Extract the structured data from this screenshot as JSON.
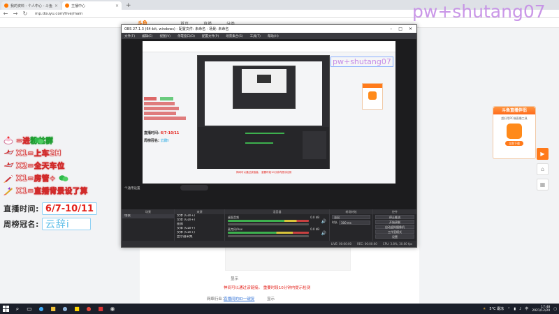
{
  "browser": {
    "tabs": [
      {
        "label": "我的资料 - 个人中心 - 斗鱼",
        "active": false,
        "favicon_color": "#ff7800"
      },
      {
        "label": "主播中心",
        "active": true,
        "favicon_color": "#ff7800"
      }
    ],
    "url": "mp.douyu.com/live/main"
  },
  "page": {
    "nav": [
      "首页",
      "直播",
      "分类"
    ],
    "notice_red": "神间可以通过该链接。 重要时段10分钟内提示检测",
    "footer_label": "网络行业：",
    "footer_link": "直播间的ID一键复",
    "footer_text": "显示"
  },
  "overlay": {
    "gifts": [
      {
        "icon": "gift-cake-icon",
        "text": "=进",
        "highlight": "粉丝群",
        "color": "#d12b2b"
      },
      {
        "icon": "gift-plane-icon",
        "text": "X1=上车2H",
        "highlight": "",
        "color": "#d12b2b"
      },
      {
        "icon": "gift-plane-icon",
        "text": "X2=全天车位",
        "highlight": "",
        "color": "#d12b2b"
      },
      {
        "icon": "gift-rocket-icon",
        "text": "X1=房管+",
        "highlight": "",
        "color": "#d12b2b"
      },
      {
        "icon": "gift-super-rocket-icon",
        "text": "X1=直播背景设了算",
        "highlight": "",
        "color": "#d12b2b"
      }
    ],
    "live_time_label": "直播时间:",
    "live_time_value": "6/7-10/11",
    "weekly_title_label": "周榜冠名:",
    "weekly_title_value": "云辞i"
  },
  "watermark": "pw+shutang07",
  "obs": {
    "title": "OBS 27.1.3 (64-bit, windows) - 配置文件: 未命名 - 场景: 未命名",
    "menu": [
      "文件(F)",
      "编辑(E)",
      "视图(V)",
      "停靠窗口(D)",
      "配置文件(P)",
      "场景集合(S)",
      "工具(T)",
      "帮助(H)"
    ],
    "canvas_watermark": "pw+shutang07",
    "docks": {
      "scenes": "场景",
      "sources": "来源",
      "mixer": "混音器",
      "transitions": "转场特效",
      "controls": "控件"
    },
    "scene_items": [
      "场景"
    ],
    "source_items": [
      "文本 (GDI+)",
      "文本 (GDI+)",
      "图像",
      "文本 (GDI+)",
      "文本 (GDI+)",
      "显示器采集"
    ],
    "mixer_channels": [
      {
        "name": "桌面音频",
        "value": "0.0 dB"
      },
      {
        "name": "麦克风/Aux",
        "value": "0.0 dB"
      }
    ],
    "transition": {
      "type": "淡出",
      "duration_label": "时长",
      "duration": "300 ms"
    },
    "controls": [
      "停止推流",
      "开始录制",
      "启动虚拟摄像机",
      "工作室模式",
      "设置",
      "退出"
    ],
    "status": {
      "live": "LIVE: 00:00:00",
      "rec": "REC: 00:00:00",
      "cpu": "CPU: 3.8%, 30.00 fps"
    },
    "scene_label": "个通用设置"
  },
  "right_promo": {
    "title": "斗鱼直播伴侣",
    "subtitle": "超好用PC端直播工具",
    "button": "立即下载"
  },
  "taskbar": {
    "weather": "5°C 霜冻",
    "time": "17:48",
    "date": "2021/12/20"
  }
}
